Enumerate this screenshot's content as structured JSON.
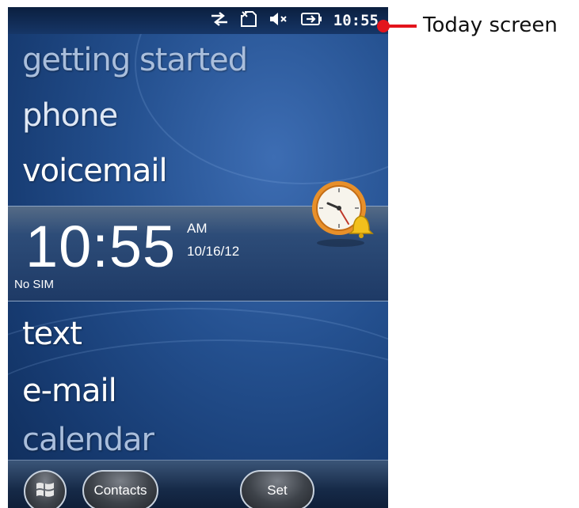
{
  "status_bar": {
    "icons": [
      "sync-arrows-icon",
      "no-sim-icon",
      "speaker-muted-icon",
      "battery-charging-icon"
    ],
    "time": "10:55"
  },
  "menu": {
    "getting_started": "getting started",
    "phone": "phone",
    "voicemail": "voicemail",
    "text": "text",
    "email": "e-mail",
    "calendar": "calendar"
  },
  "clock": {
    "time": "10:55",
    "ampm": "AM",
    "date": "10/16/12",
    "sim_status": "No SIM",
    "icon": "alarm-clock-icon"
  },
  "taskbar": {
    "start_icon": "windows-logo-icon",
    "left_softkey": "Contacts",
    "right_softkey": "Set"
  },
  "annotation": {
    "label": "Today screen",
    "color": "#e3141c"
  }
}
